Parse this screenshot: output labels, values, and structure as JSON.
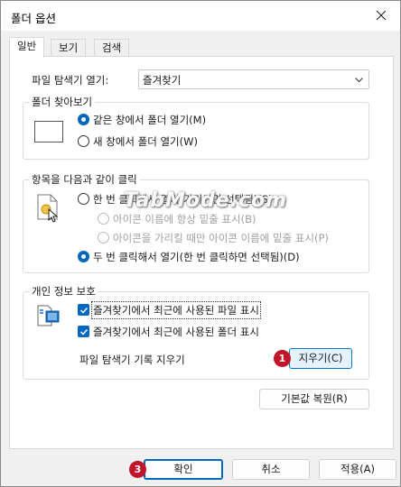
{
  "window": {
    "title": "폴더 옵션"
  },
  "tabs": [
    {
      "label": "일반",
      "active": true
    },
    {
      "label": "보기",
      "active": false
    },
    {
      "label": "검색",
      "active": false
    }
  ],
  "explorer_open": {
    "label": "파일 탐색기 열기:",
    "value": "즐겨찾기"
  },
  "browse_folders": {
    "title": "폴더 찾아보기",
    "option_same": "같은 창에서 폴더 열기(M)",
    "option_new": "새 창에서 폴더 열기(W)"
  },
  "click_items": {
    "title": "항목을 다음과 같이 클릭",
    "single_click": "한 번 클릭해서 열기(가리키면 선택됨)(S)",
    "underline_browser": "아이콘 이름에 항상 밑줄 표시(B)",
    "underline_point": "아이콘을 가리킬 때만 아이콘 이름에 밑줄 표시(P)",
    "double_click": "두 번 클릭해서 열기(한 번 클릭하면 선택됨)(D)"
  },
  "privacy": {
    "title": "개인 정보 보호",
    "recent_files": "즐겨찾기에서 최근에 사용된 파일 표시",
    "recent_folders": "즐겨찾기에서 최근에 사용된 폴더 표시",
    "clear_history_label": "파일 탐색기 기록 지우기",
    "clear_button": "지우기(C)"
  },
  "restore_defaults": "기본값 복원(R)",
  "footer": {
    "ok": "확인",
    "cancel": "취소",
    "apply": "적용(A)"
  },
  "badges": {
    "one": "1",
    "three": "3"
  },
  "watermark": "TabMode.com",
  "colors": {
    "accent": "#0067c0",
    "badge": "#c0152a"
  }
}
